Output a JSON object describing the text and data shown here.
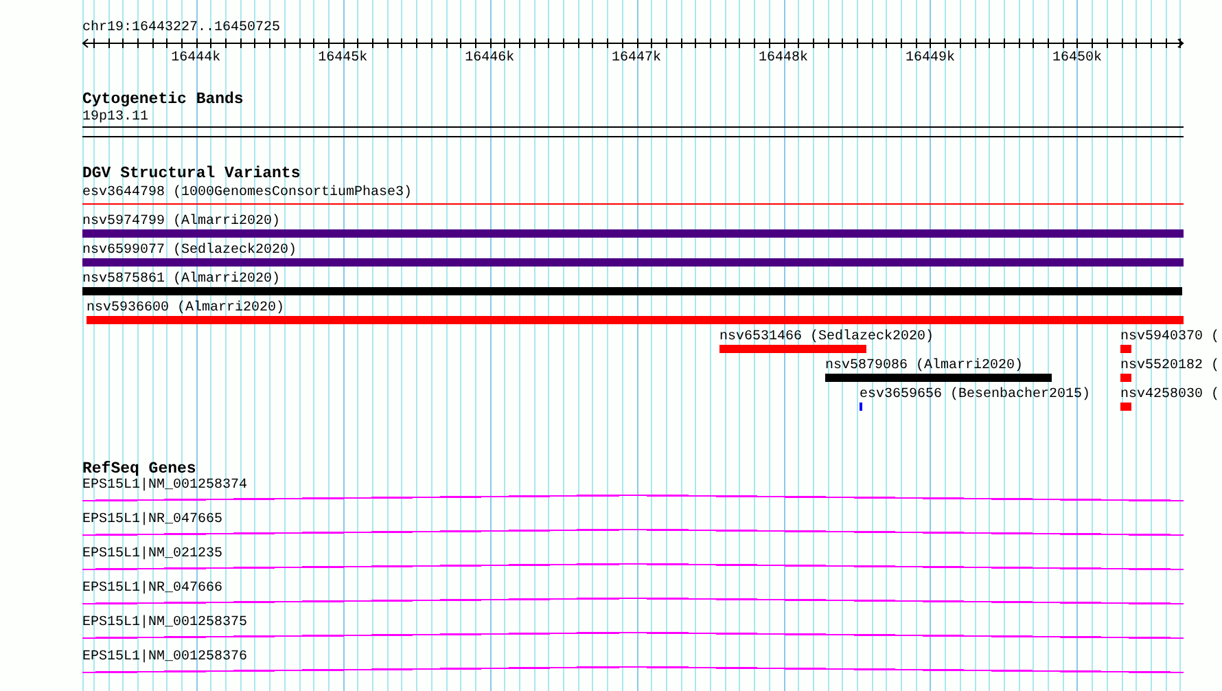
{
  "ruler": {
    "location": "chr19:16443227..16450725",
    "ticks": [
      "16444k",
      "16445k",
      "16446k",
      "16447k",
      "16448k",
      "16449k",
      "16450k"
    ]
  },
  "tracks": [
    {
      "kind": "cytoband",
      "title": "Cytogenetic Bands",
      "features": [
        {
          "label": "19p13.11"
        }
      ]
    },
    {
      "kind": "variants",
      "title": "DGV Structural Variants",
      "features": [
        {
          "label": "esv3644798 (1000GenomesConsortiumPhase3)",
          "kind": "line",
          "color": "#ff0000"
        },
        {
          "label": "nsv5974799 (Almarri2020)",
          "kind": "bar",
          "color": "#4b0082"
        },
        {
          "label": "nsv6599077 (Sedlazeck2020)",
          "kind": "bar",
          "color": "#4b0082"
        },
        {
          "label": "nsv5875861 (Almarri2020)",
          "kind": "bar",
          "color": "#000000"
        },
        {
          "label": "nsv5936600 (Almarri2020)",
          "kind": "bar",
          "color": "#ff0000"
        },
        {
          "label": "nsv6531466 (Sedlazeck2020)",
          "kind": "bar",
          "color": "#ff0000"
        },
        {
          "label": "nsv5940370 (",
          "kind": "bar",
          "color": "#ff0000"
        },
        {
          "label": "nsv5879086 (Almarri2020)",
          "kind": "bar",
          "color": "#000000"
        },
        {
          "label": "nsv5520182 (",
          "kind": "bar",
          "color": "#ff0000"
        },
        {
          "label": "esv3659656 (Besenbacher2015)",
          "kind": "bar",
          "color": "#0000ff"
        },
        {
          "label": "nsv4258030 (",
          "kind": "bar",
          "color": "#ff0000"
        }
      ]
    },
    {
      "kind": "genes",
      "title": "RefSeq Genes",
      "features": [
        {
          "label": "EPS15L1|NM_001258374"
        },
        {
          "label": "EPS15L1|NR_047665"
        },
        {
          "label": "EPS15L1|NM_021235"
        },
        {
          "label": "EPS15L1|NR_047666"
        },
        {
          "label": "EPS15L1|NM_001258375"
        },
        {
          "label": "EPS15L1|NM_001258376"
        }
      ]
    }
  ]
}
